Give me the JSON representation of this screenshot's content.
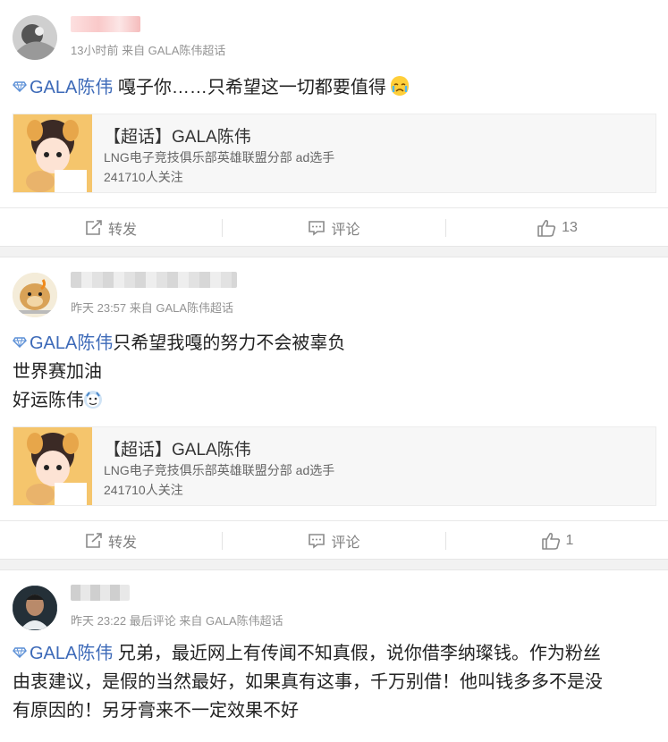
{
  "posts": [
    {
      "meta": "13小时前 来自 GALA陈伟超话",
      "topic": "GALA陈伟",
      "text_line1": " 嘎子你……只希望这一切都要值得",
      "card": {
        "title": "【超话】GALA陈伟",
        "desc": "LNG电子竞技俱乐部英雄联盟分部 ad选手",
        "followers": "241710人关注"
      },
      "actions": {
        "repost": "转发",
        "comment": "评论",
        "likes": "13"
      }
    },
    {
      "meta": "昨天 23:57 来自 GALA陈伟超话",
      "topic": "GALA陈伟",
      "text_line1": "只希望我嘎的努力不会被辜负",
      "text_line2": "世界赛加油",
      "text_line3": "好运陈伟",
      "card": {
        "title": "【超话】GALA陈伟",
        "desc": "LNG电子竞技俱乐部英雄联盟分部 ad选手",
        "followers": "241710人关注"
      },
      "actions": {
        "repost": "转发",
        "comment": "评论",
        "likes": "1"
      }
    },
    {
      "meta": "昨天 23:22 最后评论 来自 GALA陈伟超话",
      "topic": "GALA陈伟",
      "text_line1": " 兄弟，最近网上有传闻不知真假，说你借李纳璨钱。作为粉丝",
      "text_line2": "由衷建议，是假的当然最好，如果真有这事，千万别借！他叫钱多多不是没",
      "text_line3": "有原因的！另牙膏来不一定效果不好"
    }
  ],
  "icons": {
    "diamond": "diamond-icon",
    "repost": "repost-icon",
    "comment": "comment-icon",
    "like": "thumbs-up-icon"
  },
  "colors": {
    "topic": "#3d6ab8",
    "meta": "#939393",
    "background": "#f2f2f2"
  }
}
